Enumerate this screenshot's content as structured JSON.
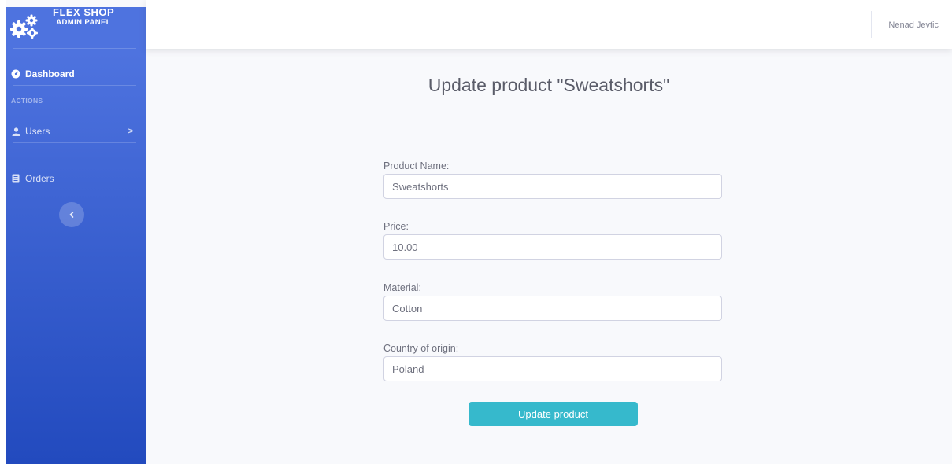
{
  "brand": {
    "line1": "FLEX SHOP",
    "line2": "ADMIN PANEL",
    "icon": "cogs-icon"
  },
  "sidebar": {
    "dashboard": {
      "label": "Dashboard",
      "icon": "tachometer-icon"
    },
    "heading": "ACTIONS",
    "users": {
      "label": "Users",
      "icon": "user-icon",
      "chevron": ">"
    },
    "orders": {
      "label": "Orders",
      "icon": "file-list-icon"
    },
    "toggle_icon": "chevron-left-icon"
  },
  "topbar": {
    "username": "Nenad Jevtic"
  },
  "form": {
    "title": "Update product \"Sweatshorts\"",
    "fields": [
      {
        "label": "Product Name:",
        "value": "Sweatshorts"
      },
      {
        "label": "Price:",
        "value": "10.00"
      },
      {
        "label": "Material:",
        "value": "Cotton"
      },
      {
        "label": "Country of origin:",
        "value": "Poland"
      }
    ],
    "submit_label": "Update product"
  },
  "colors": {
    "sidebar_top": "#4e73df",
    "sidebar_bottom": "#224abe",
    "button": "#36b9cc",
    "background": "#f8f9fc"
  }
}
